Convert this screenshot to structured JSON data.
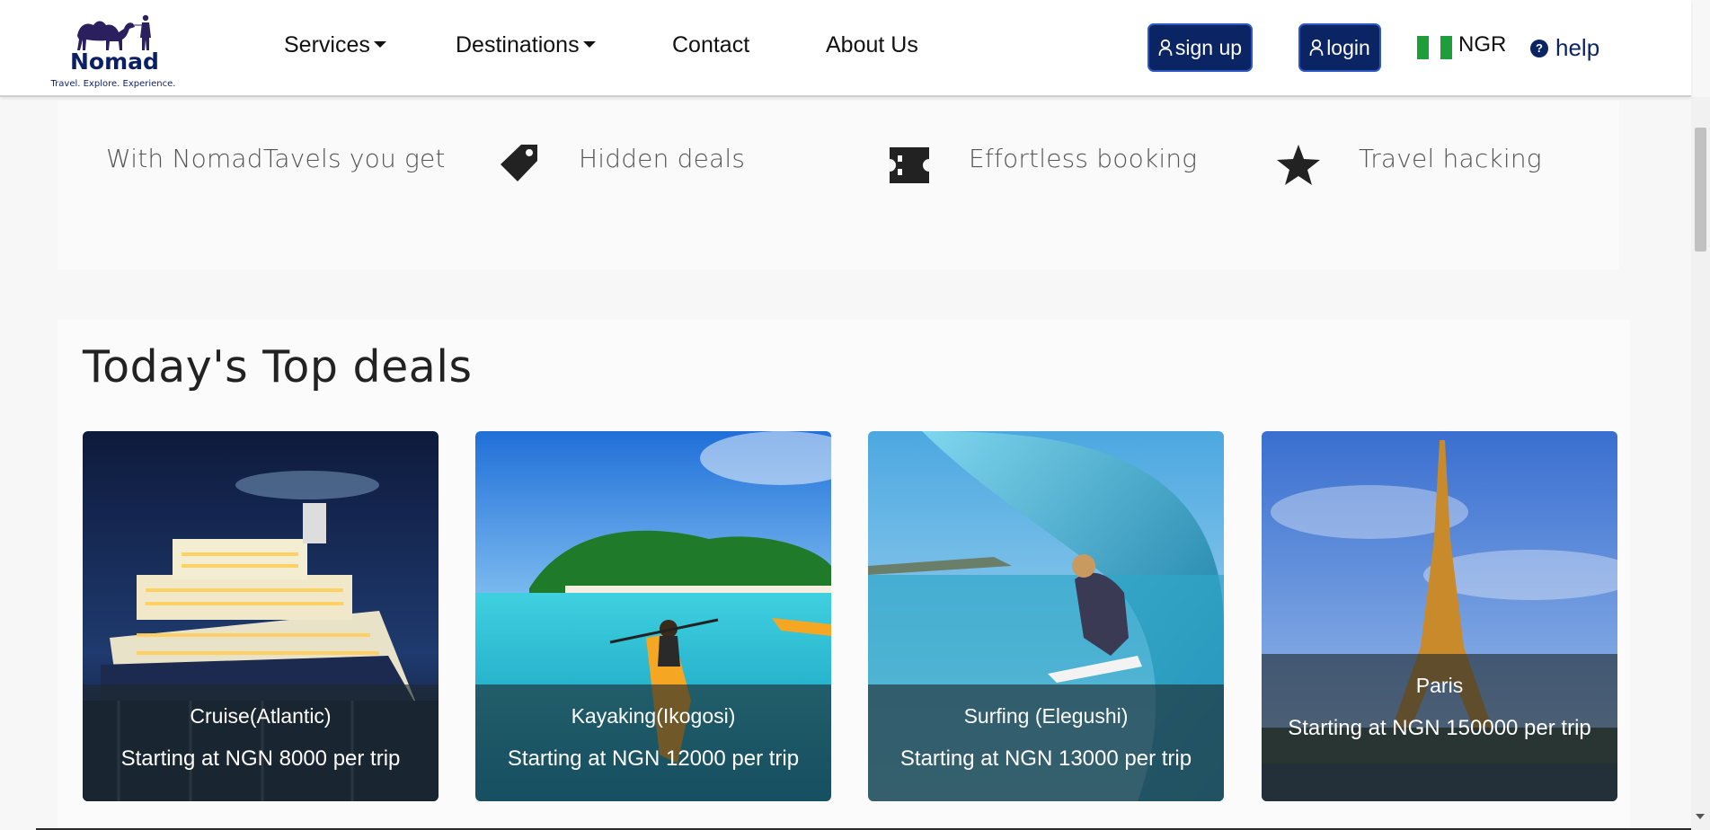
{
  "header": {
    "logo": {
      "name": "Nomad",
      "tagline": "Travel. Explore. Experience."
    },
    "nav": [
      {
        "label": "Services",
        "dropdown": true
      },
      {
        "label": "Destinations",
        "dropdown": true
      },
      {
        "label": "Contact",
        "dropdown": false
      },
      {
        "label": "About Us",
        "dropdown": false
      }
    ],
    "signup_label": "sign up",
    "login_label": "login",
    "currency": "NGR",
    "help_label": "help",
    "help_icon": "?",
    "colors": {
      "brand": "#0b2463",
      "flag_green": "#1e9e3a",
      "flag_white": "#ffffff"
    }
  },
  "benefits": {
    "intro": "With NomadTavels you get",
    "items": [
      {
        "icon": "tag-icon",
        "label": "Hidden deals"
      },
      {
        "icon": "ticket-icon",
        "label": "Effortless booking"
      },
      {
        "icon": "star-icon",
        "label": "Travel hacking"
      }
    ]
  },
  "deals": {
    "title": "Today's Top deals",
    "cards": [
      {
        "image": "cruise-ship-photo",
        "name": "Cruise(Atlantic)",
        "price": "Starting at NGN 8000 per trip"
      },
      {
        "image": "kayak-island-photo",
        "name": "Kayaking(Ikogosi)",
        "price": "Starting at NGN 12000 per trip"
      },
      {
        "image": "surfing-wave-photo",
        "name": "Surfing (Elegushi)",
        "price": "Starting at NGN 13000 per trip"
      },
      {
        "image": "eiffel-tower-photo",
        "name": "Paris",
        "price": "Starting at NGN 150000 per trip"
      }
    ]
  }
}
